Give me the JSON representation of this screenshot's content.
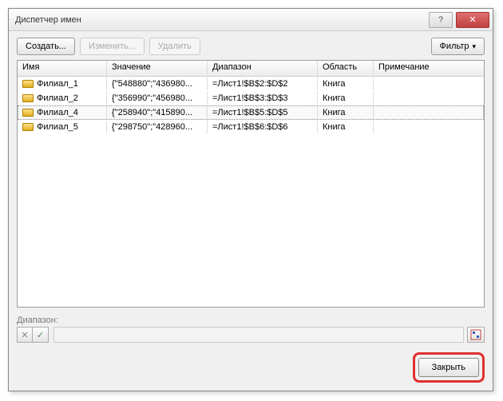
{
  "window": {
    "title": "Диспетчер имен"
  },
  "toolbar": {
    "create": "Создать...",
    "edit": "Изменить...",
    "delete": "Удалить",
    "filter": "Фильтр"
  },
  "columns": {
    "name": "Имя",
    "value": "Значение",
    "range": "Диапазон",
    "scope": "Область",
    "note": "Примечание"
  },
  "rows": [
    {
      "name": "Филиал_1",
      "value": "{\"548880\";\"436980...",
      "range": "=Лист1!$B$2:$D$2",
      "scope": "Книга",
      "note": "",
      "selected": false
    },
    {
      "name": "Филиал_2",
      "value": "{\"356990\";\"456980...",
      "range": "=Лист1!$B$3:$D$3",
      "scope": "Книга",
      "note": "",
      "selected": false
    },
    {
      "name": "Филиал_4",
      "value": "{\"258940\";\"415890...",
      "range": "=Лист1!$B$5:$D$5",
      "scope": "Книга",
      "note": "",
      "selected": true
    },
    {
      "name": "Филиал_5",
      "value": "{\"298750\";\"428960...",
      "range": "=Лист1!$B$6:$D$6",
      "scope": "Книга",
      "note": "",
      "selected": false
    }
  ],
  "rangeSection": {
    "label": "Диапазон:",
    "value": ""
  },
  "footer": {
    "close": "Закрыть"
  }
}
